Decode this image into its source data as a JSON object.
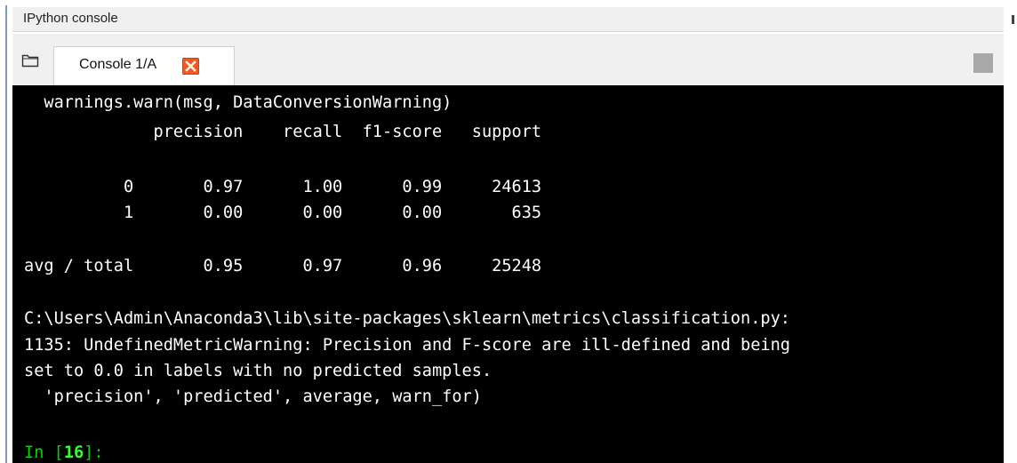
{
  "window": {
    "title": "IPython console"
  },
  "tabbar": {
    "tabs": [
      {
        "label": "Console 1/A",
        "active": true
      }
    ],
    "icons": {
      "browse": "folder-icon",
      "close": "close-icon",
      "options": "options-menu-icon"
    }
  },
  "console": {
    "text_color": "#ffffff",
    "background": "#000000",
    "prompt_color": "#00d400",
    "lines": [
      "  warnings.warn(msg, DataConversionWarning)",
      "             precision    recall  f1-score   support",
      "",
      "          0       0.97      1.00      0.99     24613",
      "          1       0.00      0.00      0.00       635",
      "",
      "avg / total       0.95      0.97      0.96     25248",
      "",
      "C:\\Users\\Admin\\Anaconda3\\lib\\site-packages\\sklearn\\metrics\\classification.py:",
      "1135: UndefinedMetricWarning: Precision and F-score are ill-defined and being",
      "set to 0.0 in labels with no predicted samples.",
      "  'precision', 'predicted', average, warn_for)"
    ],
    "prompt": {
      "prefix": "In [",
      "number": "16",
      "suffix": "]:"
    }
  }
}
